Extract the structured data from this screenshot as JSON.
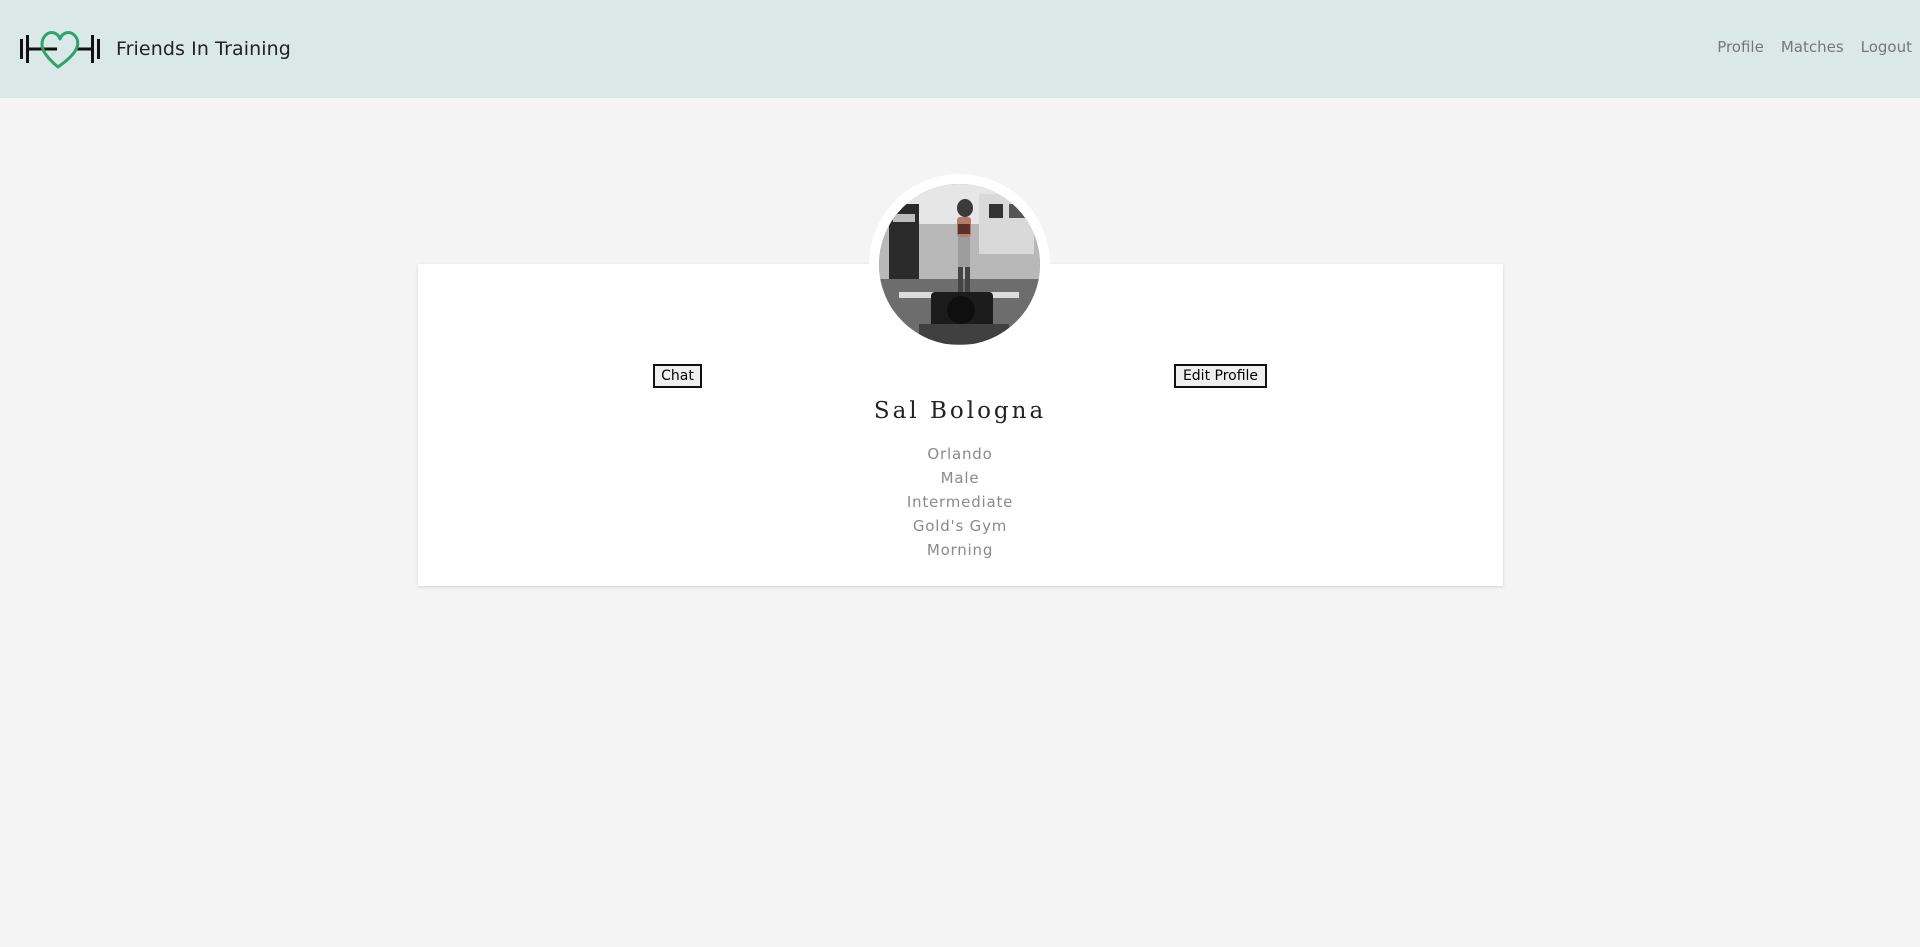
{
  "brand": {
    "title": "Friends In Training",
    "logo_icon": "dumbbell-heart-icon",
    "logo_colors": {
      "bar": "#111111",
      "heart": "#2ea36c"
    }
  },
  "nav": {
    "items": [
      {
        "label": "Profile"
      },
      {
        "label": "Matches"
      },
      {
        "label": "Logout"
      }
    ]
  },
  "profile": {
    "avatar_alt": "Profile photo",
    "name": "Sal Bologna",
    "details": [
      "Orlando",
      "Male",
      "Intermediate",
      "Gold's Gym",
      "Morning"
    ],
    "chat_label": "Chat",
    "edit_label": "Edit Profile"
  },
  "colors": {
    "navbar_bg": "#dae9e7",
    "page_bg": "#f4f4f4",
    "card_bg": "#ffffff"
  }
}
